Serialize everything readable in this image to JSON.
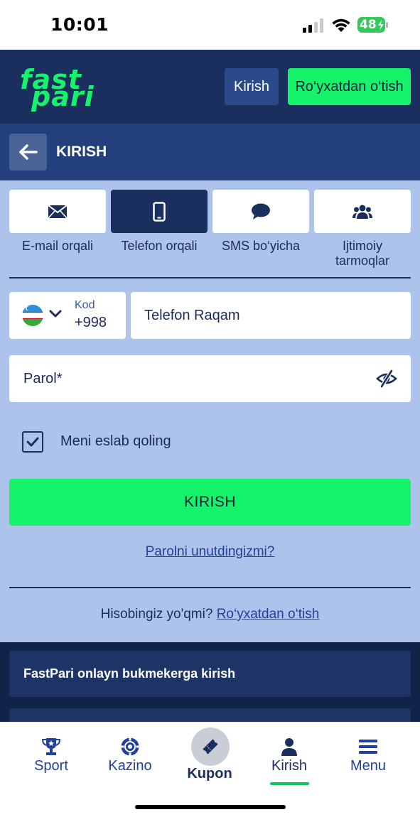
{
  "status_bar": {
    "time": "10:01",
    "battery": "48"
  },
  "header": {
    "logo_text_top": "fast",
    "logo_text_bottom": "pari",
    "login_label": "Kirish",
    "register_label": "Ro‘yxatdan o‘tish"
  },
  "title_bar": {
    "title": "KIRISH"
  },
  "tabs": [
    {
      "label": "E-mail orqali",
      "icon": "envelope-icon",
      "active": false
    },
    {
      "label": "Telefon orqali",
      "icon": "phone-icon",
      "active": true
    },
    {
      "label": "SMS bo‘yicha",
      "icon": "chat-icon",
      "active": false
    },
    {
      "label": "Ijtimoiy tarmoqlar",
      "icon": "users-icon",
      "active": false
    }
  ],
  "form": {
    "code_label": "Kod",
    "code_value": "+998",
    "phone_placeholder": "Telefon Raqam",
    "password_placeholder": "Parol*",
    "remember_label": "Meni eslab qoling",
    "remember_checked": true,
    "submit_label": "KIRISH",
    "forgot_label": "Parolni unutdingizmi?",
    "no_account_text": "Hisobingiz yo'qmi?",
    "register_link": "Ro‘yxatdan o‘tish"
  },
  "seo": {
    "card_title": "FastPari onlayn bukmekerga kirish"
  },
  "bottom_nav": {
    "items": [
      {
        "label": "Sport",
        "icon": "trophy-icon"
      },
      {
        "label": "Kazino",
        "icon": "chip-icon"
      },
      {
        "label": "Kupon",
        "icon": "ticket-icon"
      },
      {
        "label": "Kirish",
        "icon": "user-icon",
        "active": true
      },
      {
        "label": "Menu",
        "icon": "menu-icon"
      }
    ]
  },
  "colors": {
    "header_bg": "#1b2f5e",
    "accent_green": "#14f36a",
    "form_bg": "#aec3eb",
    "link_blue": "#233f9c"
  }
}
